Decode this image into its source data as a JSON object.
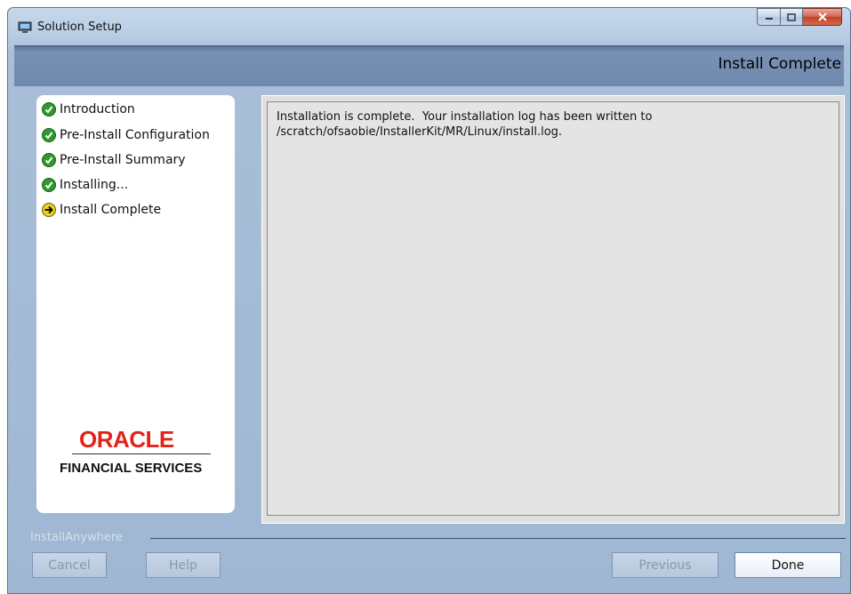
{
  "window": {
    "title": "Solution Setup",
    "header_title": "Install Complete"
  },
  "steps": [
    {
      "label": "Introduction",
      "status": "done"
    },
    {
      "label": "Pre-Install Configuration",
      "status": "done"
    },
    {
      "label": "Pre-Install Summary",
      "status": "done"
    },
    {
      "label": "Installing...",
      "status": "done"
    },
    {
      "label": "Install Complete",
      "status": "current"
    }
  ],
  "logo": {
    "line1": "ORACLE",
    "line2": "FINANCIAL SERVICES"
  },
  "content": {
    "message": "Installation is complete.  Your installation log has been written to\n/scratch/ofsaobie/InstallerKit/MR/Linux/install.log."
  },
  "footer": {
    "brand": "InstallAnywhere",
    "cancel_label": "Cancel",
    "help_label": "Help",
    "previous_label": "Previous",
    "done_label": "Done"
  },
  "colors": {
    "done_icon": "#2e9a2e",
    "current_icon": "#e8d020",
    "oracle_red": "#e2231a"
  }
}
